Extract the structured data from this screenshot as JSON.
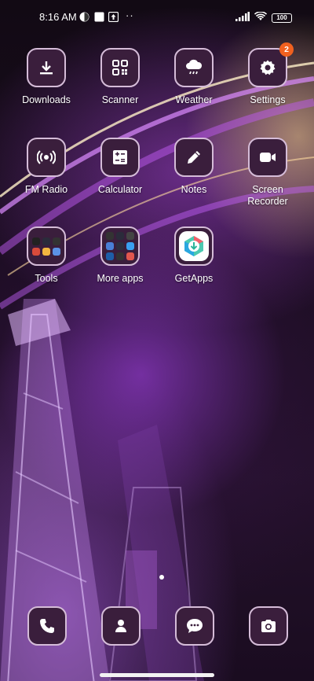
{
  "status_bar": {
    "time": "8:16 AM",
    "more_indicator": "··",
    "battery": "100",
    "icons": [
      "cast-icon",
      "image-icon",
      "upload-icon",
      "signal-icon",
      "wifi-icon",
      "battery-icon"
    ]
  },
  "apps": [
    {
      "label": "Downloads",
      "icon": "download-icon"
    },
    {
      "label": "Scanner",
      "icon": "qr-scanner-icon"
    },
    {
      "label": "Weather",
      "icon": "cloud-rain-icon"
    },
    {
      "label": "Settings",
      "icon": "gear-icon",
      "badge": "2"
    },
    {
      "label": "FM Radio",
      "icon": "radio-icon"
    },
    {
      "label": "Calculator",
      "icon": "calculator-icon"
    },
    {
      "label": "Notes",
      "icon": "pencil-icon"
    },
    {
      "label": "Screen Recorder",
      "label_line1": "Screen",
      "label_line2": "Recorder",
      "icon": "video-camera-icon"
    },
    {
      "label": "Tools",
      "icon": "folder-icon"
    },
    {
      "label": "More apps",
      "icon": "folder-icon"
    },
    {
      "label": "GetApps",
      "icon": "getapps-icon"
    }
  ],
  "dock": [
    {
      "name": "Phone",
      "icon": "phone-icon"
    },
    {
      "name": "Contacts",
      "icon": "contact-icon"
    },
    {
      "name": "Messaging",
      "icon": "chat-bubble-icon"
    },
    {
      "name": "Camera",
      "icon": "camera-icon"
    }
  ],
  "colors": {
    "icon_bg": "#3a1e3c",
    "icon_border": "#d5bcd8",
    "badge": "#f0611f"
  }
}
